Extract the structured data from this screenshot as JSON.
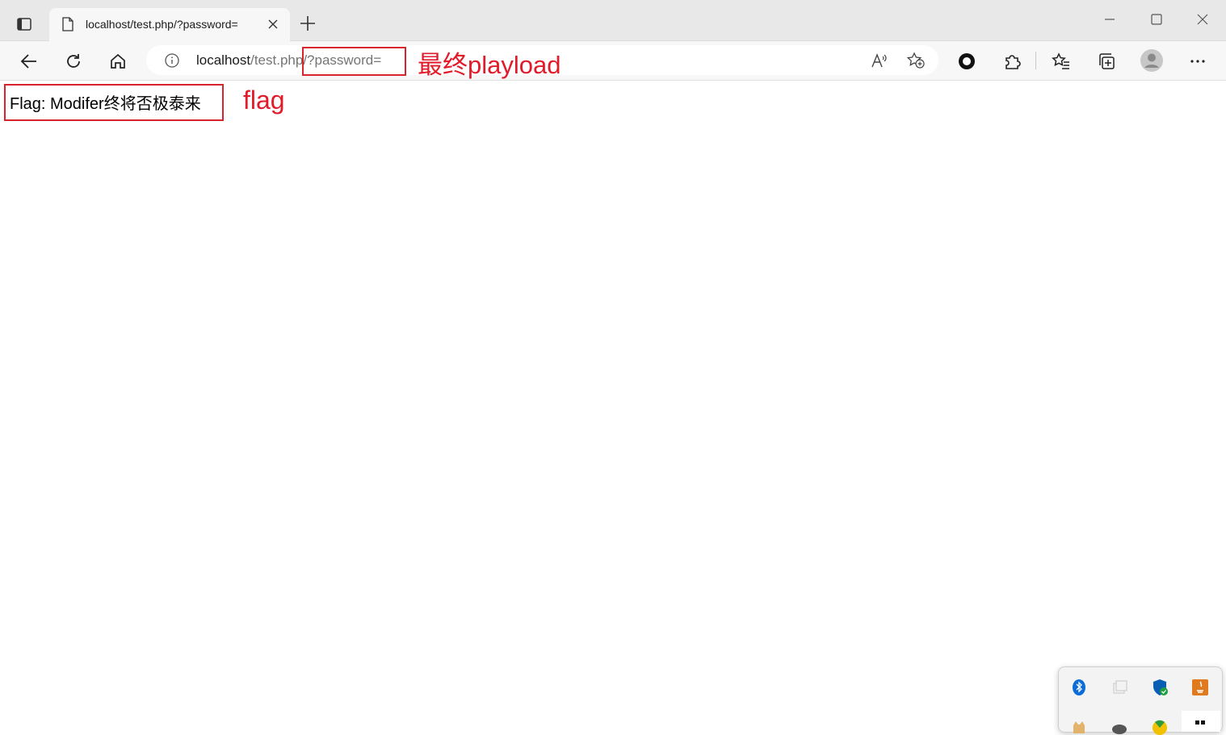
{
  "tab": {
    "title": "localhost/test.php/?password="
  },
  "address_bar": {
    "host": "localhost",
    "path": "/test.php/?password="
  },
  "page": {
    "flag_text": "Flag: Modifer终将否极泰来"
  },
  "annotations": {
    "payload_label": "最终playload",
    "flag_label": "flag",
    "color": "#e11b2a"
  },
  "icons": {
    "tab_actions": "tab-actions-icon",
    "favicon": "page-icon",
    "close": "close-icon",
    "new_tab": "plus-icon",
    "back": "back-arrow-icon",
    "refresh": "refresh-icon",
    "home": "home-icon",
    "site_info": "info-icon",
    "read_aloud": "read-aloud-icon",
    "add_favorite": "star-add-icon",
    "extension_record": "record-icon",
    "extensions": "puzzle-icon",
    "favorites": "favorites-icon",
    "collections": "collections-icon",
    "profile": "avatar-icon",
    "more": "more-icon"
  }
}
